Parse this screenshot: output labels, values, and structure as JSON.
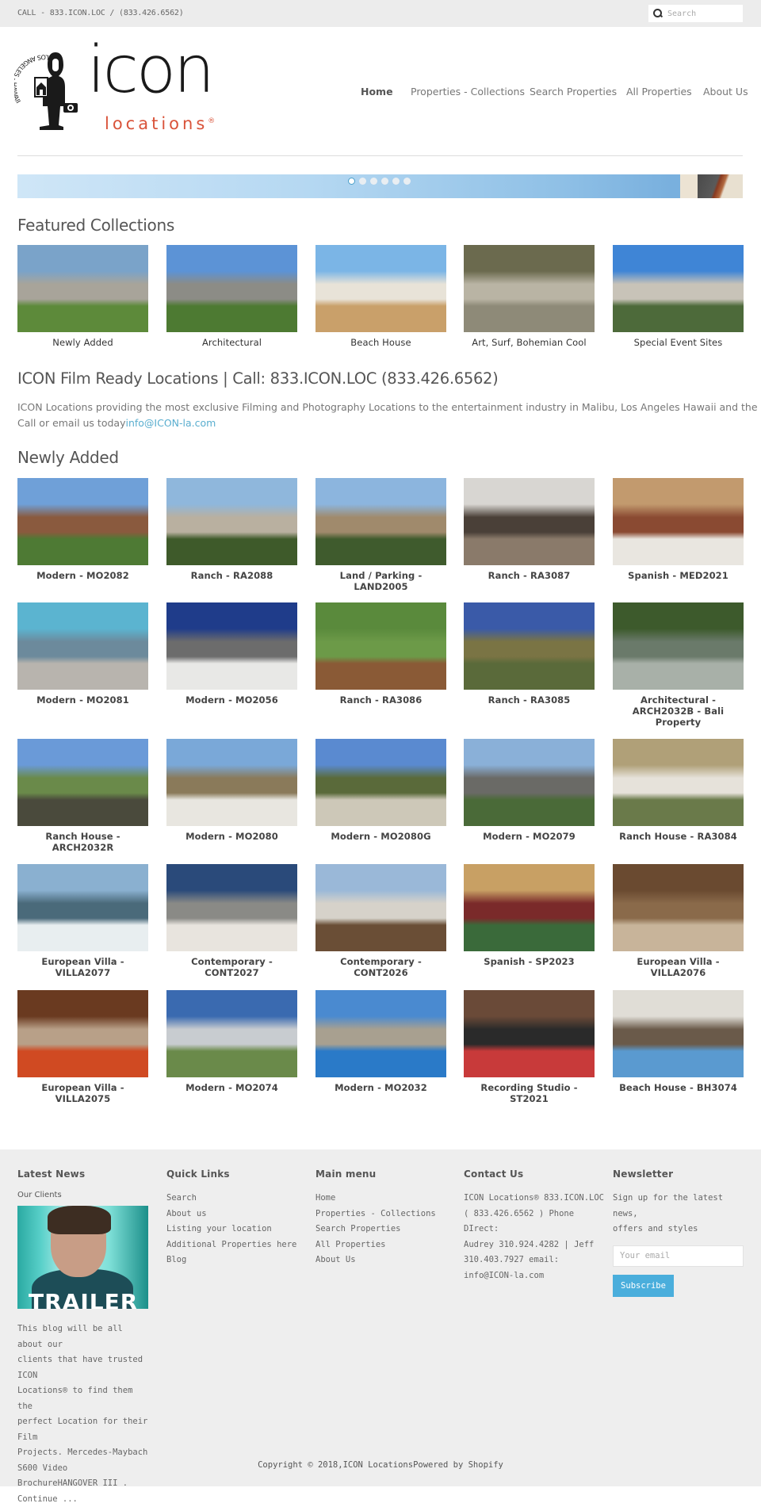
{
  "topbar": {
    "call_text": "CALL - 833.ICON.LOC / (833.426.6562)",
    "search_placeholder": "Search"
  },
  "logo": {
    "arc_text": "LOS ANGELES - HAWAII",
    "main": "icon",
    "sub": "locations",
    "reg": "®"
  },
  "nav": {
    "items": [
      {
        "label": "Home",
        "active": true
      },
      {
        "label": "Properties - Collections"
      },
      {
        "label": "Search Properties"
      },
      {
        "label": "All Properties"
      },
      {
        "label": "About Us"
      }
    ]
  },
  "slider": {
    "slide_count": 6,
    "active_index": 0
  },
  "featured": {
    "title": "Featured Collections",
    "items": [
      {
        "label": "Newly Added",
        "colors": [
          "#7aa3c9",
          "#5d8a3a",
          "#a8a49a"
        ]
      },
      {
        "label": "Architectural",
        "colors": [
          "#5c93d6",
          "#4d7a32",
          "#8c8c86"
        ]
      },
      {
        "label": "Beach House",
        "colors": [
          "#7bb5e6",
          "#c9a06a",
          "#e8e3d8"
        ]
      },
      {
        "label": "Art, Surf, Bohemian Cool",
        "colors": [
          "#6b6a4e",
          "#8e8a78",
          "#b9b4a4"
        ]
      },
      {
        "label": "Special Event Sites",
        "colors": [
          "#3f85d6",
          "#4d6a3a",
          "#c8c3b8"
        ]
      }
    ]
  },
  "intro": {
    "heading": "ICON Film Ready Locations | Call: 833.ICON.LOC (833.426.6562)",
    "line1": "ICON Locations providing the most exclusive Filming and Photography Locations to the entertainment industry in Malibu, Los Angeles Hawaii and the surrounding",
    "line2_prefix": "Call or email us today",
    "email": "info@ICON-la.com"
  },
  "newly_added": {
    "title": "Newly Added",
    "items": [
      {
        "label": "Modern - MO2082",
        "colors": [
          "#6fa0d8",
          "#4e7a34",
          "#8a5a3e"
        ]
      },
      {
        "label": "Ranch - RA2088",
        "colors": [
          "#8fb7dc",
          "#3e5a2a",
          "#b9b0a0"
        ]
      },
      {
        "label": "Land / Parking - LAND2005",
        "colors": [
          "#8cb5de",
          "#3f5b2d",
          "#a08a6c"
        ]
      },
      {
        "label": "Ranch - RA3087",
        "colors": [
          "#d8d6d2",
          "#8a7a6a",
          "#4a4038"
        ]
      },
      {
        "label": "Spanish - MED2021",
        "colors": [
          "#c29a6e",
          "#e9e6e0",
          "#8a4a32"
        ]
      },
      {
        "label": "Modern - MO2081",
        "colors": [
          "#5bb4d0",
          "#b8b4ae",
          "#6c8a9c"
        ]
      },
      {
        "label": "Modern - MO2056",
        "colors": [
          "#1f3c8a",
          "#e8e8e6",
          "#6c6c6c"
        ]
      },
      {
        "label": "Ranch - RA3086",
        "colors": [
          "#5a8a3c",
          "#8a5a36",
          "#6c9a48"
        ]
      },
      {
        "label": "Ranch - RA3085",
        "colors": [
          "#3a5aa8",
          "#5a6a3a",
          "#7a7444"
        ]
      },
      {
        "label": "Architectural - ARCH2032B - Bali Property",
        "colors": [
          "#3d5a2c",
          "#a8b0a8",
          "#6a7a6a"
        ]
      },
      {
        "label": "Ranch House - ARCH2032R",
        "colors": [
          "#6a9ad8",
          "#4a4a3c",
          "#6a8a4a"
        ]
      },
      {
        "label": "Modern - MO2080",
        "colors": [
          "#7aa8d8",
          "#e8e6e0",
          "#8a7a5a"
        ]
      },
      {
        "label": "Modern - MO2080G",
        "colors": [
          "#5a8ad0",
          "#cdc8b8",
          "#5a6a3a"
        ]
      },
      {
        "label": "Modern - MO2079",
        "colors": [
          "#8ab0d8",
          "#4a6a38",
          "#6a6a66"
        ]
      },
      {
        "label": "Ranch House - RA3084",
        "colors": [
          "#b0a078",
          "#6a7a4a",
          "#e6e2da"
        ]
      },
      {
        "label": "European Villa - VILLA2077",
        "colors": [
          "#8ab0d0",
          "#e8eef0",
          "#4a6a7a"
        ]
      },
      {
        "label": "Contemporary - CONT2027",
        "colors": [
          "#2a4a7a",
          "#e8e4de",
          "#8a8a86"
        ]
      },
      {
        "label": "Contemporary - CONT2026",
        "colors": [
          "#9ab8d8",
          "#6a4e36",
          "#d6d2ca"
        ]
      },
      {
        "label": "Spanish - SP2023",
        "colors": [
          "#c8a064",
          "#3a6a3a",
          "#7a2a2a"
        ]
      },
      {
        "label": "European Villa - VILLA2076",
        "colors": [
          "#6a4a30",
          "#c8b49a",
          "#8a6a4a"
        ]
      },
      {
        "label": "European Villa - VILLA2075",
        "colors": [
          "#6a3a20",
          "#d04a22",
          "#b8a088"
        ]
      },
      {
        "label": "Modern - MO2074",
        "colors": [
          "#3a6ab0",
          "#6a8a4a",
          "#c8ccd0"
        ]
      },
      {
        "label": "Modern - MO2032",
        "colors": [
          "#4a8ad0",
          "#2a7ac8",
          "#a8a090"
        ]
      },
      {
        "label": "Recording Studio - ST2021",
        "colors": [
          "#6a4a38",
          "#c83a3a",
          "#2a2a2a"
        ]
      },
      {
        "label": "Beach House - BH3074",
        "colors": [
          "#e0ddd6",
          "#5a9ad0",
          "#6a5a4a"
        ]
      }
    ]
  },
  "footer": {
    "latest_news": {
      "title": "Latest News",
      "post_title": "Our Clients",
      "image_overlay": "TRAILER",
      "excerpt_lines": [
        "This blog will be all about our",
        "clients that have trusted ICON",
        "Locations® to find them the",
        "perfect Location for their Film",
        "Projects. Mercedes-Maybach",
        "S600 Video",
        "BrochureHANGOVER III ."
      ],
      "continue": "Continue ..."
    },
    "quick_links": {
      "title": "Quick Links",
      "items": [
        "Search",
        "About us",
        "Listing your location",
        "Additional Properties here",
        "Blog"
      ]
    },
    "main_menu": {
      "title": "Main menu",
      "items": [
        "Home",
        "Properties - Collections",
        "Search Properties",
        "All Properties",
        "About Us"
      ]
    },
    "contact": {
      "title": "Contact Us",
      "lines": [
        "ICON Locations® 833.ICON.LOC",
        "( 833.426.6562 ) Phone DIrect:",
        "Audrey 310.924.4282 | Jeff",
        "310.403.7927 email:",
        "info@ICON-la.com"
      ]
    },
    "newsletter": {
      "title": "Newsletter",
      "lines": [
        "Sign up for the latest news,",
        "offers and styles"
      ],
      "email_placeholder": "Your email",
      "button": "Subscribe"
    },
    "copyright": "Copyright © 2018,ICON LocationsPowered by Shopify"
  },
  "colors": {
    "accent_blue": "#4aaedc",
    "link_blue": "#5aaecf",
    "logo_red": "#d9533a"
  }
}
